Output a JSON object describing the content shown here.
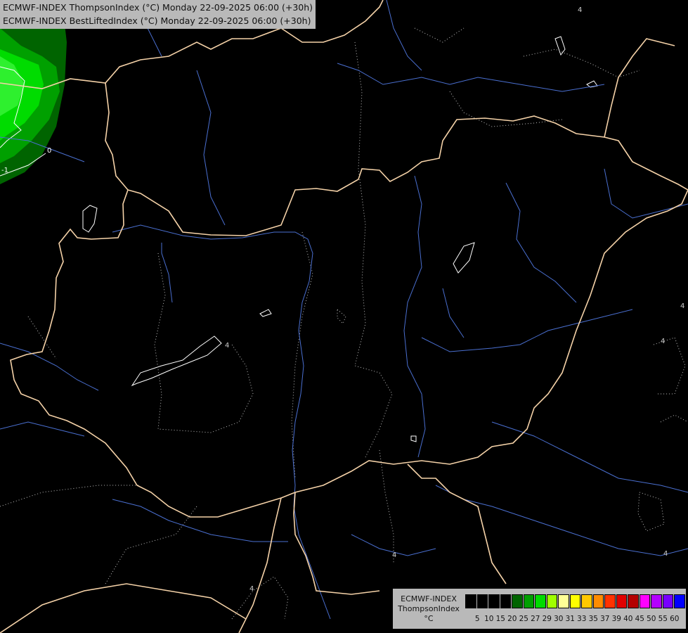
{
  "header": {
    "line1": "ECMWF-INDEX ThompsonIndex (°C) Monday 22-09-2025 06:00 (+30h)",
    "line2": "ECMWF-INDEX BestLiftedIndex (°C) Monday 22-09-2025 06:00 (+30h)"
  },
  "legend": {
    "title_line1": "ECMWF-INDEX",
    "title_line2": "ThompsonIndex",
    "title_line3": "°C",
    "ticks": [
      "5",
      "10",
      "15",
      "20",
      "25",
      "27",
      "29",
      "30",
      "31",
      "33",
      "35",
      "37",
      "39",
      "40",
      "45",
      "50",
      "55",
      "60"
    ],
    "colors": [
      "#000000",
      "#000000",
      "#000000",
      "#000000",
      "#006400",
      "#00a000",
      "#00dc00",
      "#a0ff00",
      "#ffff96",
      "#ffff00",
      "#ffc800",
      "#ff8c00",
      "#ff3200",
      "#e10000",
      "#b40000",
      "#ff00ff",
      "#b400ff",
      "#7800ff",
      "#0000ff"
    ]
  },
  "map_labels": {
    "contour_label_neg1": "-1",
    "contour_label_0": "0",
    "contour_label_4": "4"
  },
  "colors": {
    "background": "#000000",
    "border": "#f5d2a8",
    "river": "#4a6fd0",
    "contour": "#ffffff"
  }
}
